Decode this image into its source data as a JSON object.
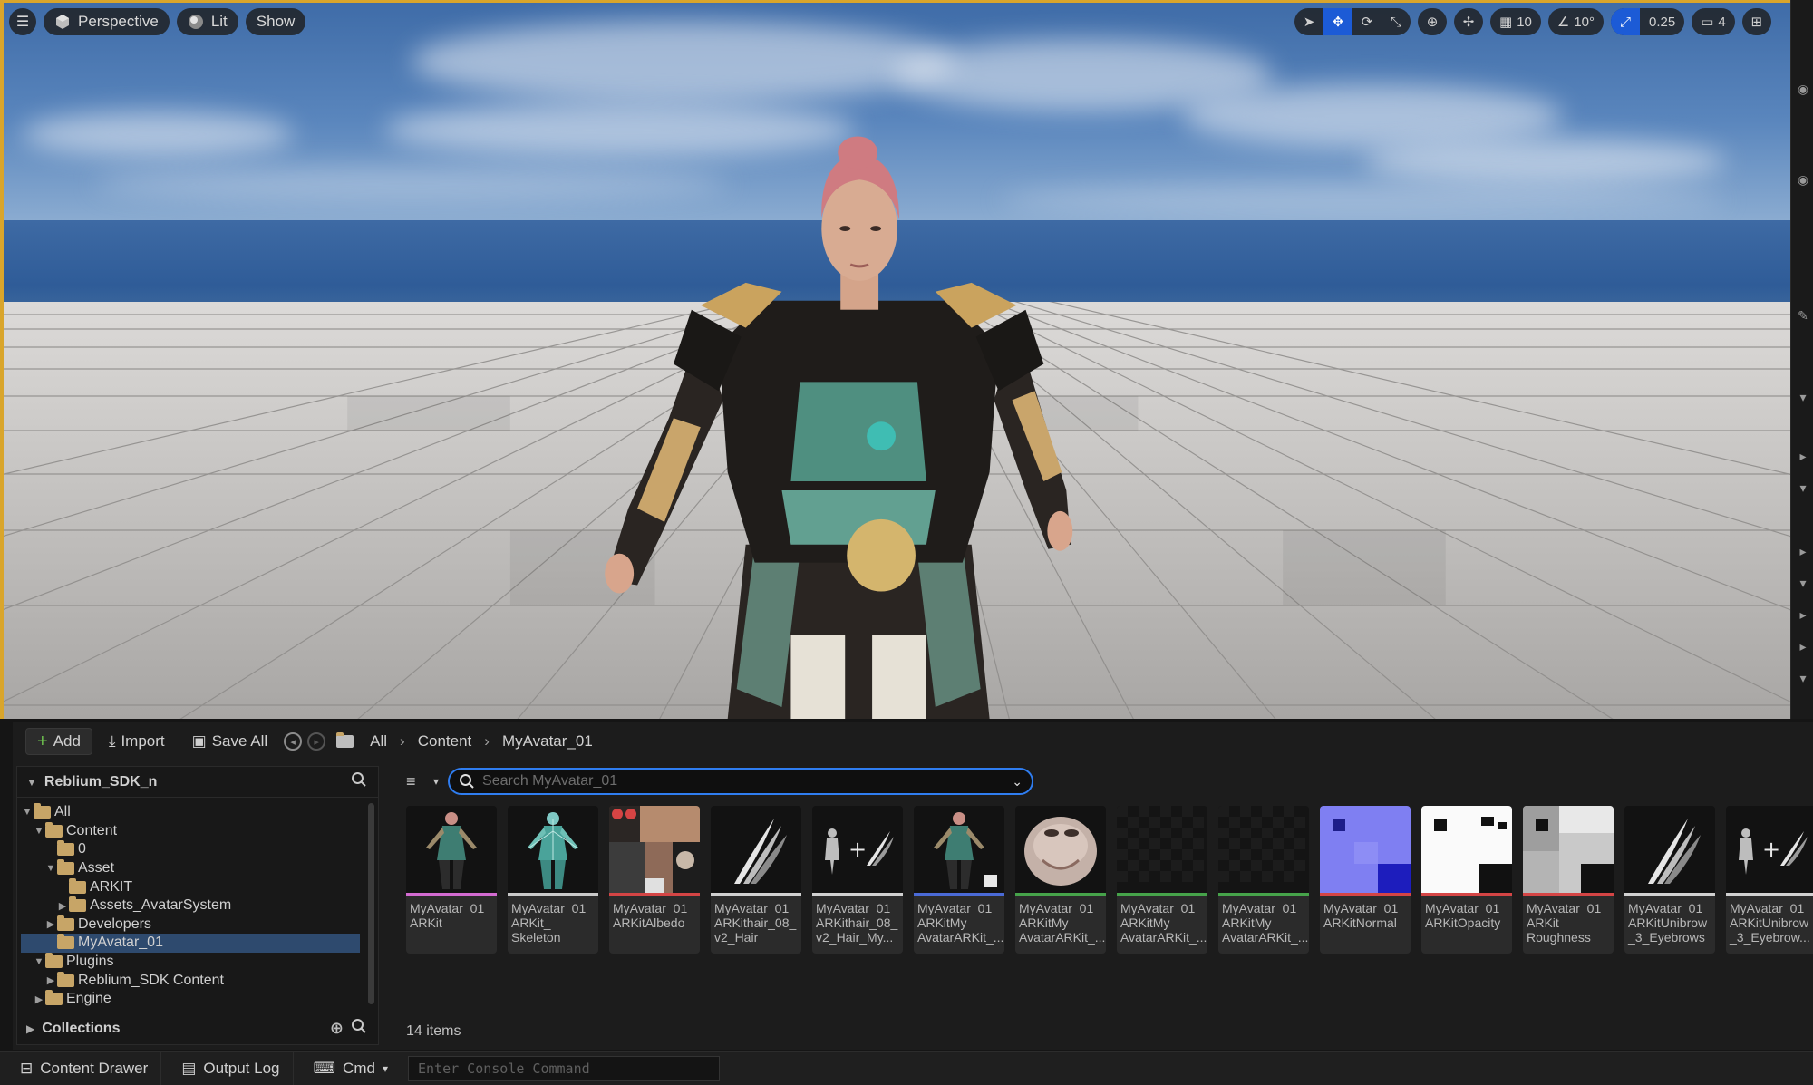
{
  "viewport": {
    "left_toolbar": {
      "menu_icon": "hamburger-icon",
      "perspective_label": "Perspective",
      "lit_label": "Lit",
      "show_label": "Show"
    },
    "right_toolbar": {
      "grid_snap_value": "10",
      "rotation_snap_value": "10°",
      "scale_snap_value": "0.25",
      "camera_speed_value": "4"
    },
    "accent_color": "#d9a52b"
  },
  "content_browser": {
    "toolbar": {
      "add_label": "Add",
      "import_label": "Import",
      "save_all_label": "Save All"
    },
    "breadcrumb": [
      "All",
      "Content",
      "MyAvatar_01"
    ],
    "tree": {
      "root_label": "Reblium_SDK_n",
      "items": [
        {
          "label": "All",
          "level": 0,
          "expanded": true
        },
        {
          "label": "Content",
          "level": 1,
          "expanded": true
        },
        {
          "label": "0",
          "level": 2,
          "expanded": false
        },
        {
          "label": "Asset",
          "level": 2,
          "expanded": true
        },
        {
          "label": "ARKIT",
          "level": 3,
          "expanded": false
        },
        {
          "label": "Assets_AvatarSystem",
          "level": 3,
          "expanded": false
        },
        {
          "label": "Developers",
          "level": 2,
          "expanded": false
        },
        {
          "label": "MyAvatar_01",
          "level": 2,
          "expanded": false,
          "selected": true
        },
        {
          "label": "Plugins",
          "level": 1,
          "expanded": true
        },
        {
          "label": "Reblium_SDK Content",
          "level": 2,
          "expanded": false
        },
        {
          "label": "Engine",
          "level": 1,
          "expanded": false
        }
      ],
      "collections_label": "Collections"
    },
    "search_placeholder": "Search MyAvatar_01",
    "assets": [
      {
        "label": "MyAvatar_01_ ARKit",
        "thumb": "character",
        "color": "#d36bd1"
      },
      {
        "label": "MyAvatar_01_ ARKit_ Skeleton",
        "thumb": "skeleton",
        "color": "#c9c9c9"
      },
      {
        "label": "MyAvatar_01_ ARKitAlbedo",
        "thumb": "albedo",
        "color": "#d44545"
      },
      {
        "label": "MyAvatar_01_ ARKithair_08_ v2_Hair",
        "thumb": "hair",
        "color": "#d0d0d0"
      },
      {
        "label": "MyAvatar_01_ ARKithair_08_ v2_Hair_My...",
        "thumb": "binding",
        "color": "#d0d0d0"
      },
      {
        "label": "MyAvatar_01_ ARKitMy AvatarARKit_...",
        "thumb": "character2",
        "color": "#4a6ad6"
      },
      {
        "label": "MyAvatar_01_ ARKitMy AvatarARKit_...",
        "thumb": "head",
        "color": "#46a34a"
      },
      {
        "label": "MyAvatar_01_ ARKitMy AvatarARKit_...",
        "thumb": "dark",
        "color": "#46a34a"
      },
      {
        "label": "MyAvatar_01_ ARKitMy AvatarARKit_...",
        "thumb": "dark",
        "color": "#46a34a"
      },
      {
        "label": "MyAvatar_01_ ARKitNormal",
        "thumb": "normal",
        "color": "#d44545"
      },
      {
        "label": "MyAvatar_01_ ARKitOpacity",
        "thumb": "opacity",
        "color": "#d44545"
      },
      {
        "label": "MyAvatar_01_ ARKit Roughness",
        "thumb": "rough",
        "color": "#d44545"
      },
      {
        "label": "MyAvatar_01_ ARKitUnibrow _3_Eyebrows",
        "thumb": "hair",
        "color": "#d0d0d0"
      },
      {
        "label": "MyAvatar_01_ ARKitUnibrow _3_Eyebrow...",
        "thumb": "binding",
        "color": "#d0d0d0"
      }
    ],
    "item_count": "14 items"
  },
  "statusbar": {
    "content_drawer_label": "Content Drawer",
    "output_log_label": "Output Log",
    "cmd_label": "Cmd",
    "console_placeholder": "Enter Console Command"
  }
}
